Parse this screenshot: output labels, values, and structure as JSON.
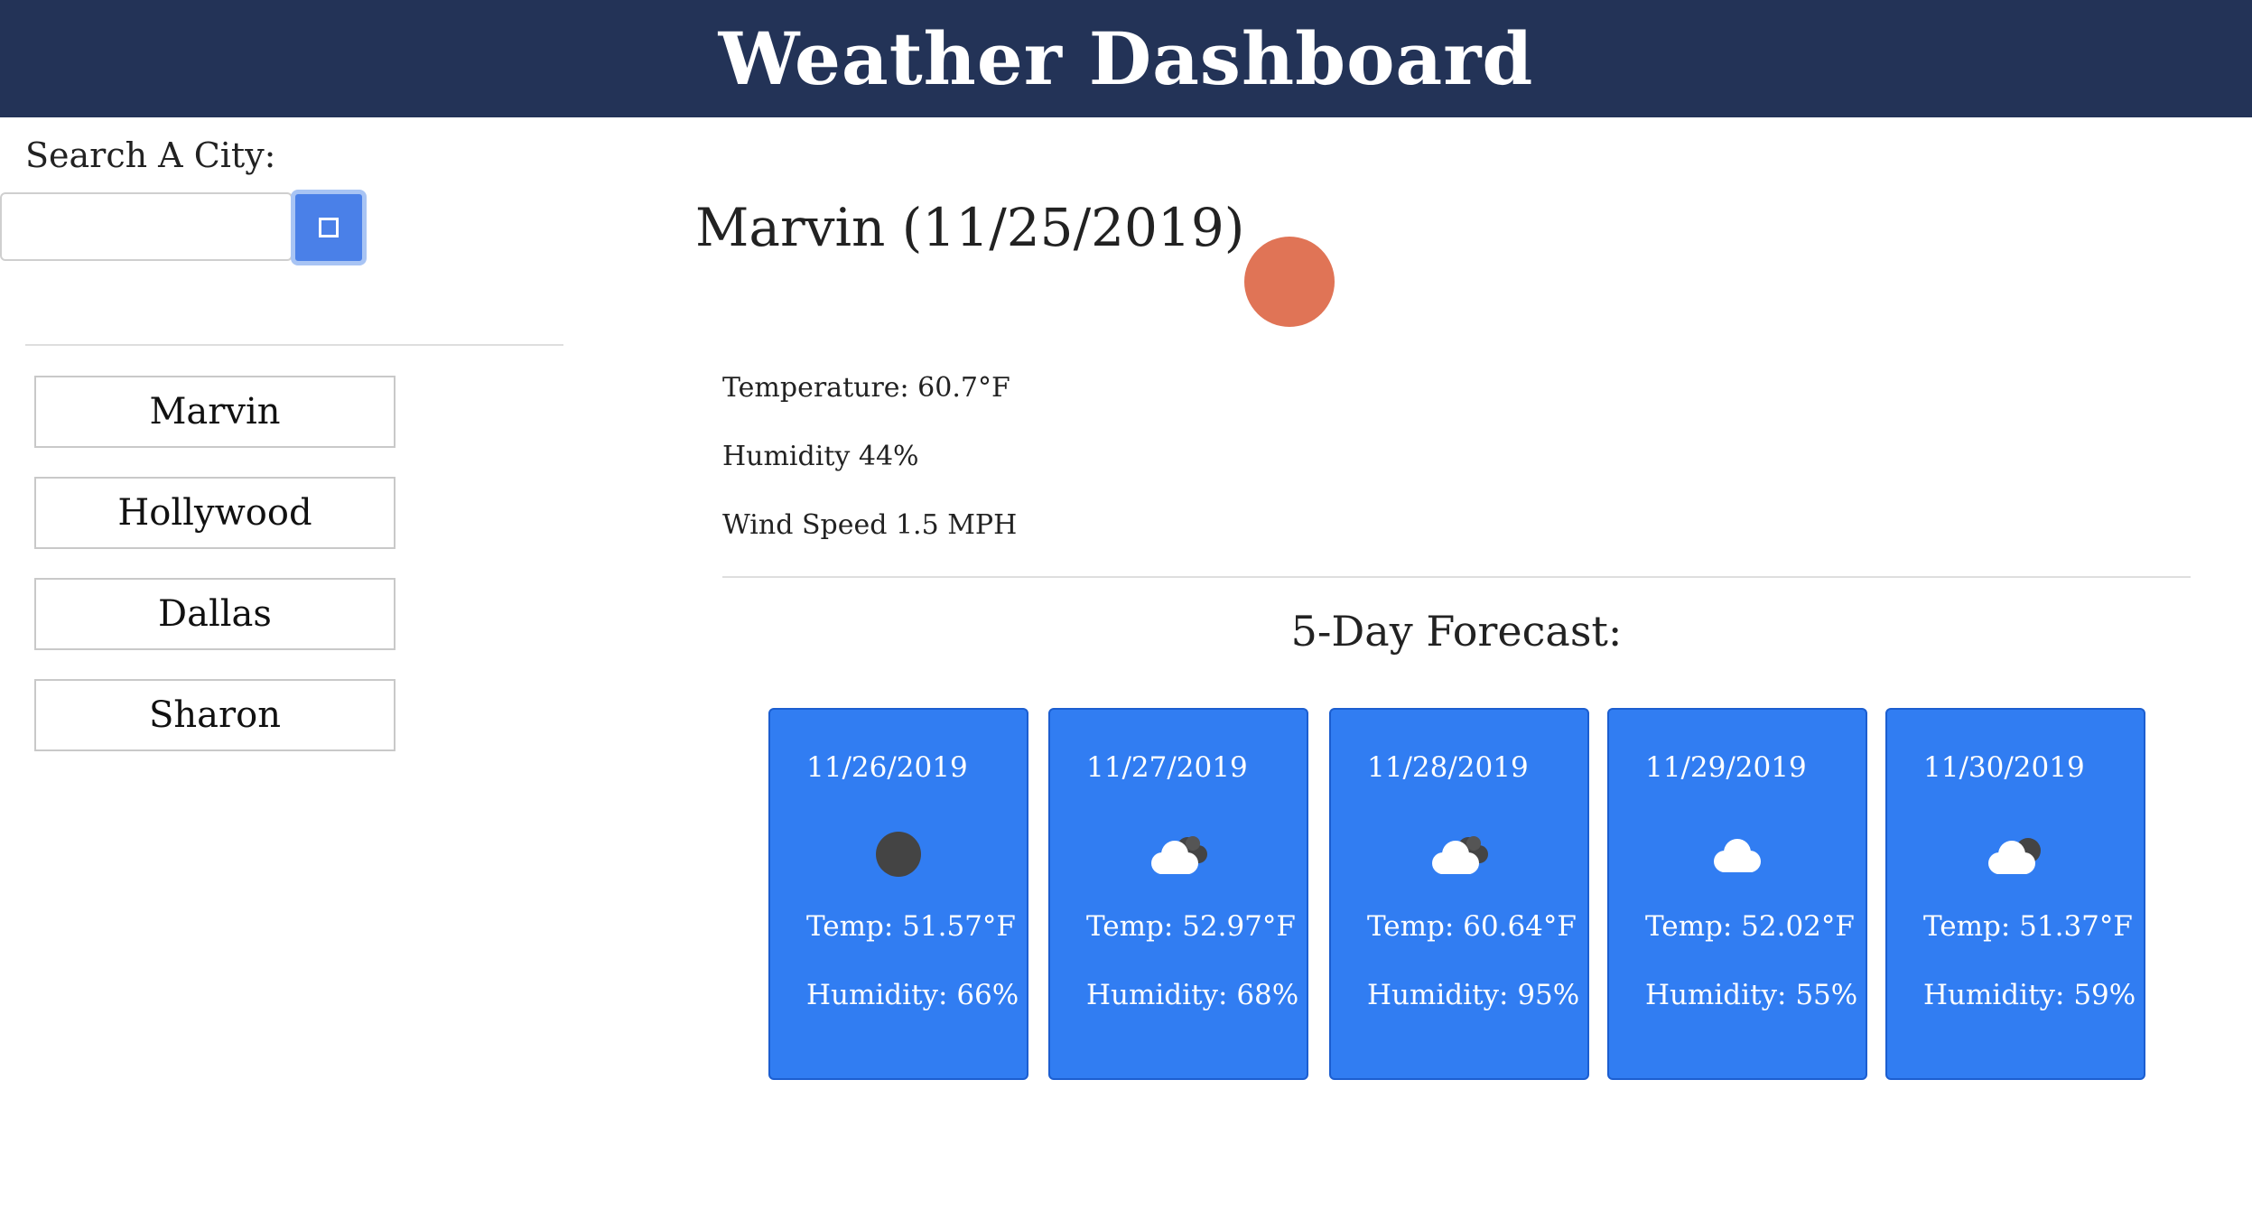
{
  "header": {
    "title": "Weather Dashboard"
  },
  "search": {
    "label": "Search A City:",
    "value": "",
    "placeholder": ""
  },
  "cities": [
    "Marvin",
    "Hollywood",
    "Dallas",
    "Sharon"
  ],
  "current": {
    "title": "Marvin (11/25/2019)",
    "icon": "sun-icon",
    "temperature": "Temperature: 60.7°F",
    "humidity": "Humidity 44%",
    "wind": "Wind Speed 1.5 MPH"
  },
  "forecast": {
    "title": "5-Day Forecast:",
    "days": [
      {
        "date": "11/26/2019",
        "icon": "clear-night-icon",
        "temp": "Temp: 51.57°F",
        "humidity": "Humidity: 66%"
      },
      {
        "date": "11/27/2019",
        "icon": "cloudy-night-icon",
        "temp": "Temp: 52.97°F",
        "humidity": "Humidity: 68%"
      },
      {
        "date": "11/28/2019",
        "icon": "cloudy-night-icon",
        "temp": "Temp: 60.64°F",
        "humidity": "Humidity: 95%"
      },
      {
        "date": "11/29/2019",
        "icon": "cloud-icon",
        "temp": "Temp: 52.02°F",
        "humidity": "Humidity: 55%"
      },
      {
        "date": "11/30/2019",
        "icon": "partly-cloudy-night-icon",
        "temp": "Temp: 51.37°F",
        "humidity": "Humidity: 59%"
      }
    ]
  },
  "colors": {
    "header_bg": "#233357",
    "card_bg": "#317df2",
    "search_button": "#4a80e8",
    "sun": "#e07456"
  }
}
